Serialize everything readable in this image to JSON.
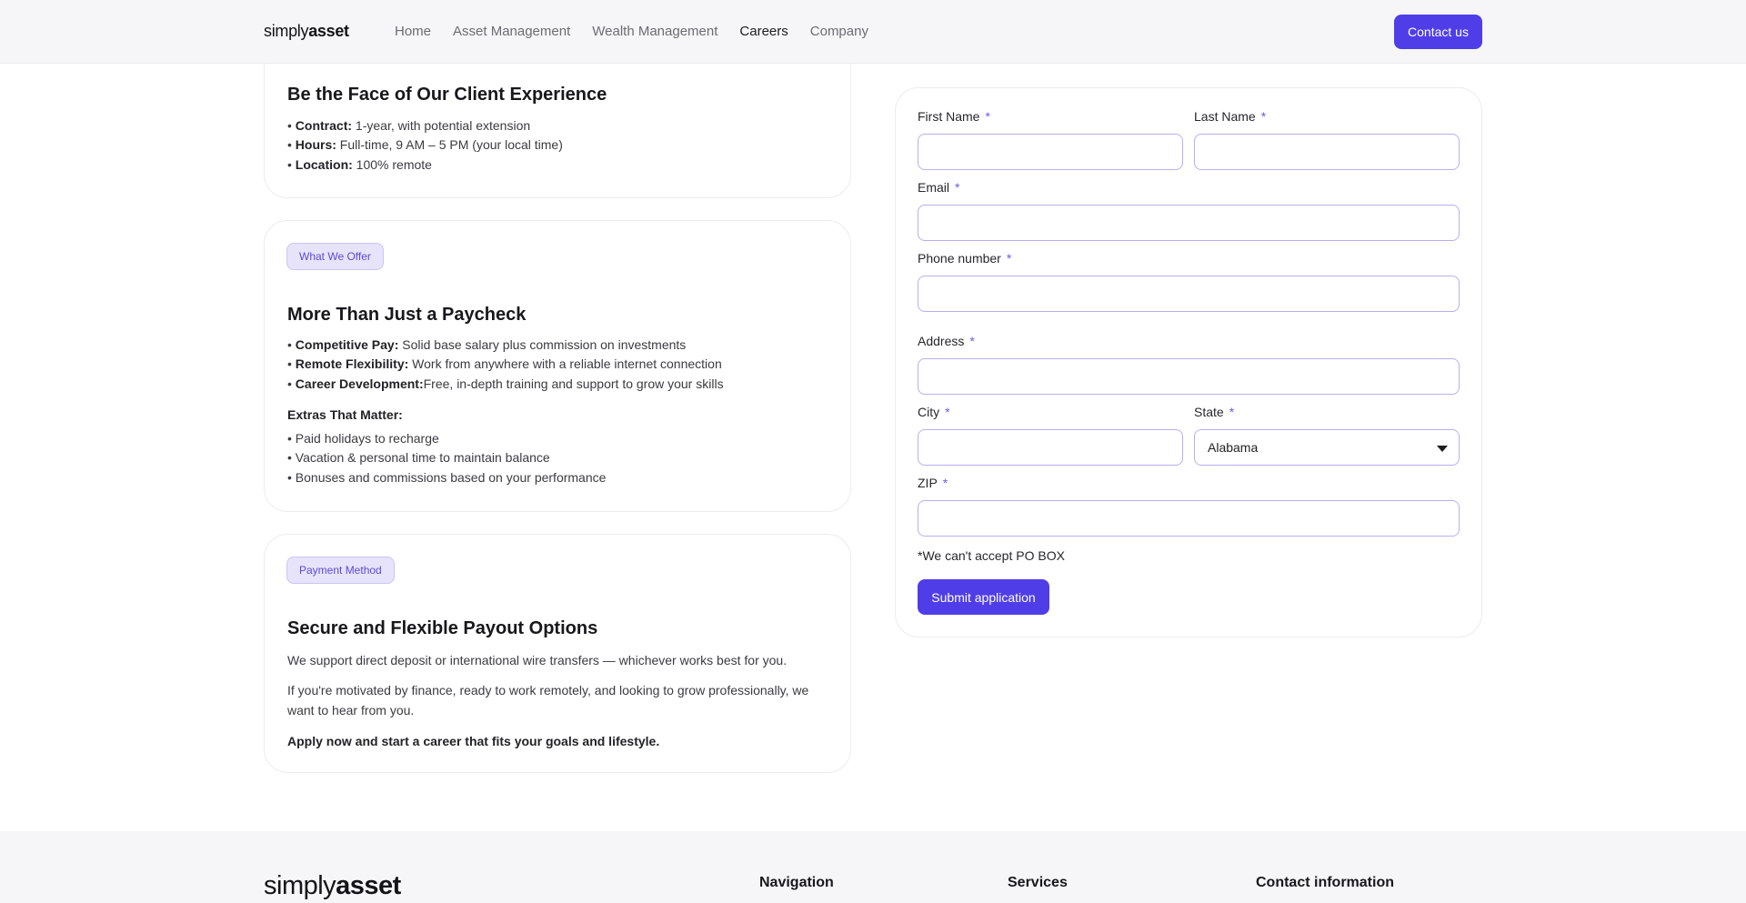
{
  "header": {
    "logo_part1": "simply",
    "logo_part2": "asset",
    "nav": [
      "Home",
      "Asset Management",
      "Wealth Management",
      "Careers",
      "Company"
    ],
    "active_nav": "Careers",
    "contact_button": "Contact us"
  },
  "card1": {
    "title": "Be the Face of Our Client Experience",
    "items": [
      {
        "label": "Contract:",
        "text": " 1-year, with potential extension"
      },
      {
        "label": "Hours:",
        "text": " Full-time, 9 AM – 5 PM (your local time)"
      },
      {
        "label": "Location:",
        "text": " 100% remote"
      }
    ]
  },
  "card2": {
    "pill": "What We Offer",
    "title": "More Than Just a Paycheck",
    "items": [
      {
        "label": "Competitive Pay:",
        "text": " Solid base salary plus commission on investments"
      },
      {
        "label": "Remote Flexibility:",
        "text": " Work from anywhere with a reliable internet connection"
      },
      {
        "label": "Career Development:",
        "text": "Free, in-depth training and support to grow your skills"
      }
    ],
    "extras_heading": "Extras That Matter:",
    "extras": [
      "• Paid holidays to recharge",
      "• Vacation & personal time to maintain balance",
      "• Bonuses and commissions based on your performance"
    ]
  },
  "card3": {
    "pill": "Payment Method",
    "title": "Secure and Flexible Payout Options",
    "para1": "We support direct deposit or international wire transfers — whichever works best for you.",
    "para2": "If you're motivated by finance, ready to work remotely, and looking to grow professionally, we want to hear from you.",
    "para3": "Apply now and start a career that fits your goals and lifestyle."
  },
  "form": {
    "first_name_label": "First Name",
    "last_name_label": "Last Name",
    "email_label": "Email",
    "phone_label": "Phone number",
    "address_label": "Address",
    "city_label": "City",
    "state_label": "State",
    "state_value": "Alabama",
    "zip_label": "ZIP",
    "required_mark": "*",
    "po_box_note": "*We can't accept PO BOX",
    "submit_label": "Submit application"
  },
  "footer": {
    "logo_part1": "simply",
    "logo_part2": "asset",
    "navigation_heading": "Navigation",
    "services_heading": "Services",
    "contact_heading": "Contact information"
  },
  "colors": {
    "accent": "#4f3ee8",
    "pill_bg": "#e6e3fb",
    "input_border": "#b7b0ee"
  }
}
